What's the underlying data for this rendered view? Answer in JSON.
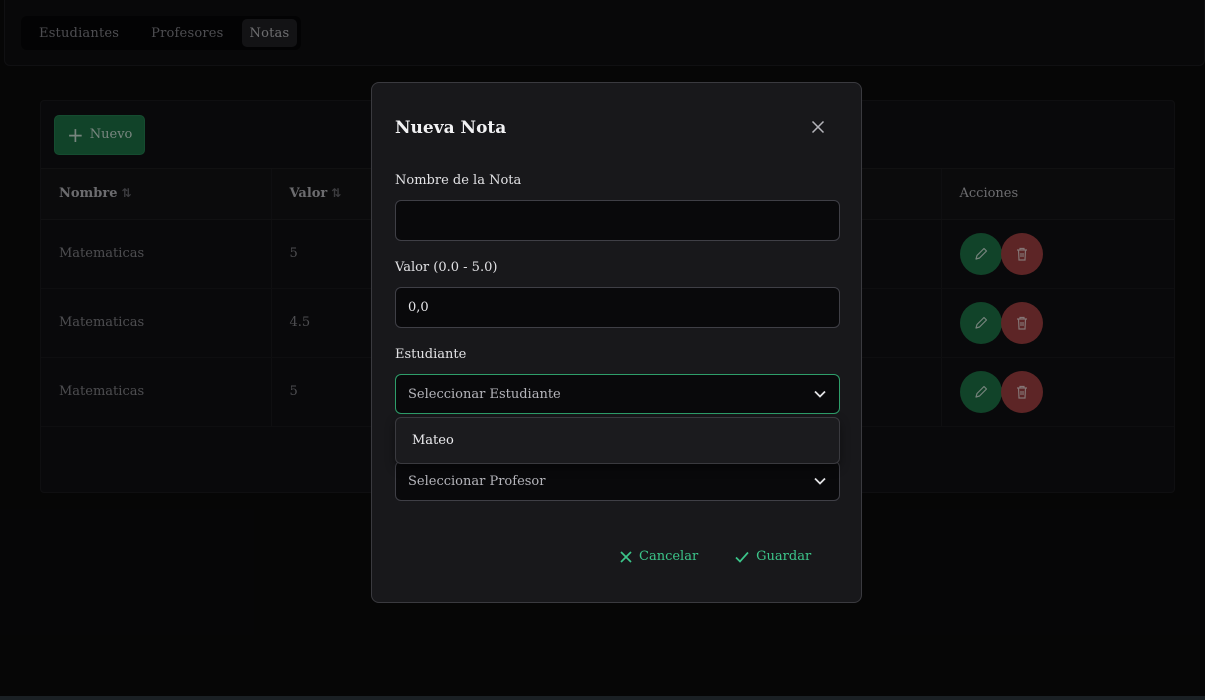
{
  "menubar": {
    "items": [
      {
        "label": "Estudiantes",
        "active": false
      },
      {
        "label": "Profesores",
        "active": false
      },
      {
        "label": "Notas",
        "active": true
      }
    ]
  },
  "toolbar": {
    "new_label": "Nuevo",
    "new_icon": "plus-icon"
  },
  "table": {
    "columns": [
      "Nombre",
      "Valor",
      "",
      "Acciones"
    ],
    "rows": [
      {
        "nombre": "Matematicas",
        "valor": "5"
      },
      {
        "nombre": "Matematicas",
        "valor": "4.5"
      },
      {
        "nombre": "Matematicas",
        "valor": "5"
      }
    ]
  },
  "dialog": {
    "title": "Nueva Nota",
    "nombre_label": "Nombre de la Nota",
    "nombre_value": "",
    "valor_label": "Valor (0.0 - 5.0)",
    "valor_value": "0,0",
    "estudiante_label": "Estudiante",
    "estudiante_placeholder": "Seleccionar Estudiante",
    "estudiante_options": [
      "Mateo"
    ],
    "profesor_placeholder": "Seleccionar Profesor",
    "cancel_label": "Cancelar",
    "save_label": "Guardar"
  },
  "colors": {
    "accent_green": "#1f7a4c",
    "text_green": "#3cc58a",
    "danger_red": "#a94445",
    "background": "#0b0b0c"
  }
}
